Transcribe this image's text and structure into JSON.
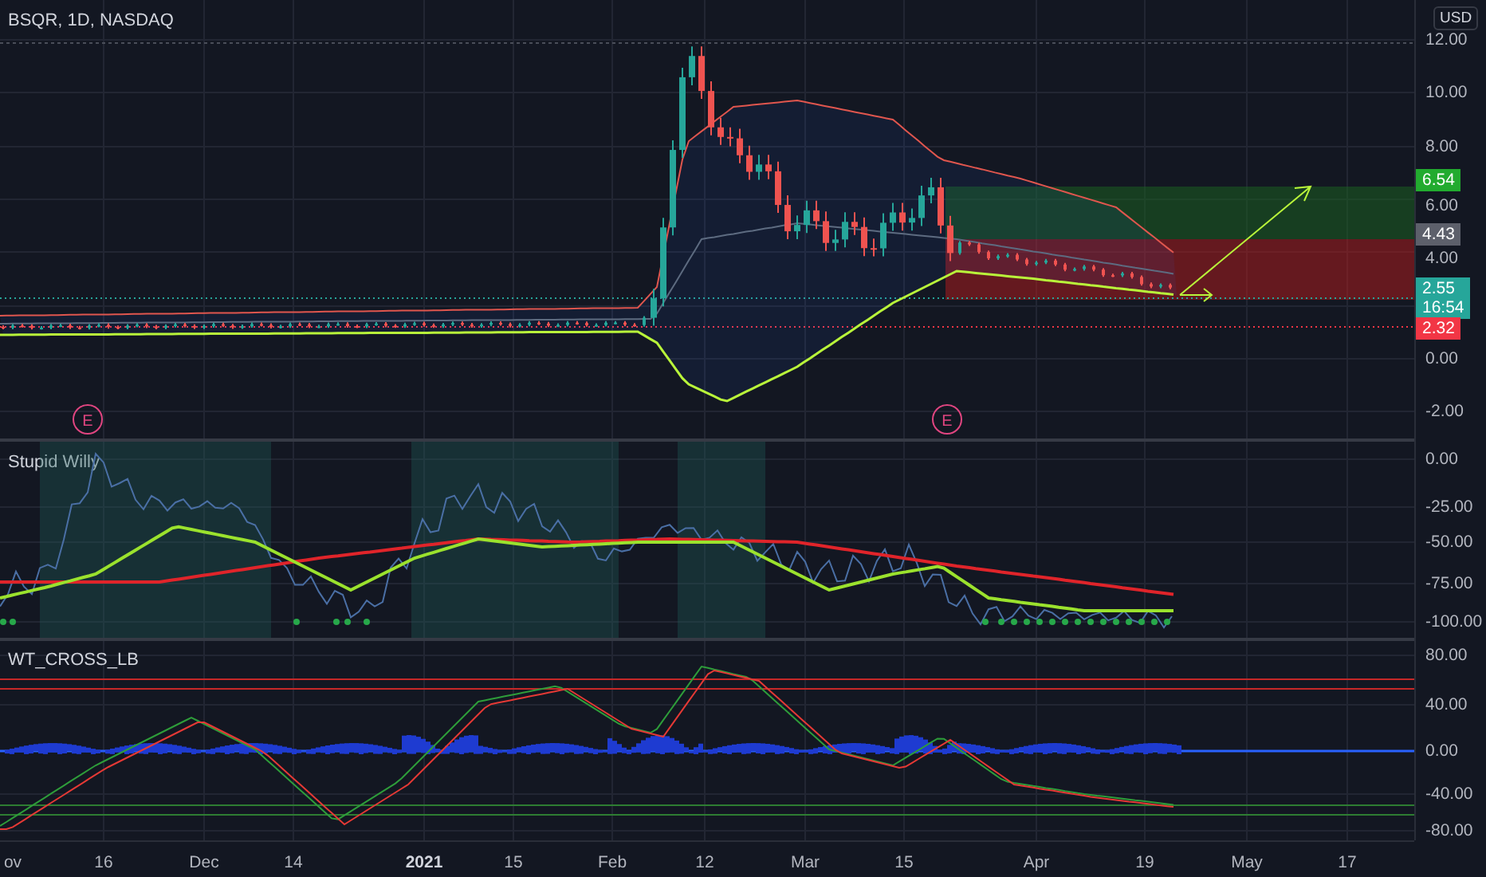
{
  "chart_title": "BSQR, 1D, NASDAQ",
  "currency": "USD",
  "price_pane": {
    "axis_labels": [
      "12.00",
      "10.00",
      "8.00",
      "6.00",
      "4.00",
      "0.00",
      "-2.00"
    ],
    "price_tags": [
      {
        "text": "6.54",
        "color": "#22ab2f"
      },
      {
        "text": "4.43",
        "color": "#5d606b"
      },
      {
        "text": "2.55",
        "subtext": "16:54",
        "color": "#26a69a"
      },
      {
        "text": "2.32",
        "color": "#f23645"
      }
    ],
    "earnings_markers": [
      "E",
      "E"
    ]
  },
  "oscillator_pane": {
    "title": "Stupid Willy",
    "axis_labels": [
      "0.00",
      "-25.00",
      "-50.00",
      "-75.00",
      "-100.00"
    ]
  },
  "wavetrend_pane": {
    "title": "WT_CROSS_LB",
    "axis_labels": [
      "80.00",
      "40.00",
      "0.00",
      "-40.00",
      "-80.00"
    ]
  },
  "time_axis": [
    {
      "text": "ov",
      "kind": "period"
    },
    {
      "text": "16",
      "kind": "period"
    },
    {
      "text": "Dec",
      "kind": "period"
    },
    {
      "text": "14",
      "kind": "period"
    },
    {
      "text": "2021",
      "kind": "year"
    },
    {
      "text": "15",
      "kind": "period"
    },
    {
      "text": "Feb",
      "kind": "period"
    },
    {
      "text": "12",
      "kind": "period"
    },
    {
      "text": "Mar",
      "kind": "period"
    },
    {
      "text": "15",
      "kind": "period"
    },
    {
      "text": "Apr",
      "kind": "period"
    },
    {
      "text": "19",
      "kind": "period"
    },
    {
      "text": "May",
      "kind": "period"
    },
    {
      "text": "17",
      "kind": "period"
    }
  ]
}
